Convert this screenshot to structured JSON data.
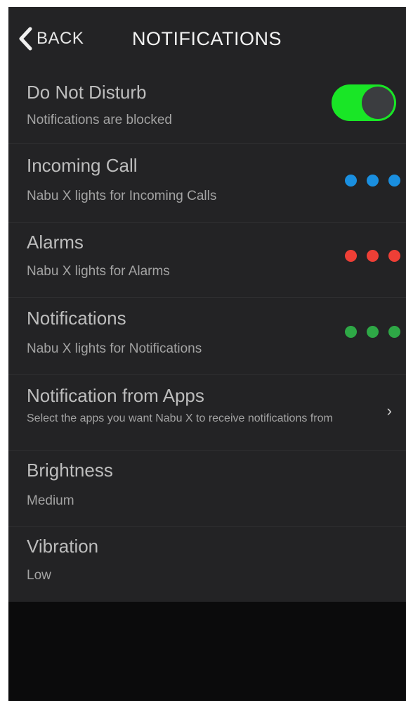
{
  "nav": {
    "back_label": "BACK",
    "title": "NOTIFICATIONS"
  },
  "rows": [
    {
      "title": "Do Not Disturb",
      "subtitle": "Notifications are blocked",
      "control": "toggle",
      "toggle_on": true,
      "toggle_color": "#19e626"
    },
    {
      "title": "Incoming Call",
      "subtitle": "Nabu X lights for Incoming Calls",
      "control": "dots",
      "dot_color": "#1a8fe0"
    },
    {
      "title": "Alarms",
      "subtitle": "Nabu X lights for Alarms",
      "control": "dots",
      "dot_color": "#ee3f36"
    },
    {
      "title": "Notifications",
      "subtitle": "Nabu X lights for Notifications",
      "control": "dots",
      "dot_color": "#2ea846"
    },
    {
      "title": "Notification from Apps",
      "subtitle": "Select the apps you want Nabu X to receive notifications from",
      "control": "chevron",
      "chevron_glyph": "›"
    },
    {
      "title": "Brightness",
      "subtitle": "Medium"
    },
    {
      "title": "Vibration",
      "subtitle": "Low"
    }
  ],
  "icons": {
    "back": "chevron-left-icon",
    "chevron": "chevron-right-icon"
  }
}
